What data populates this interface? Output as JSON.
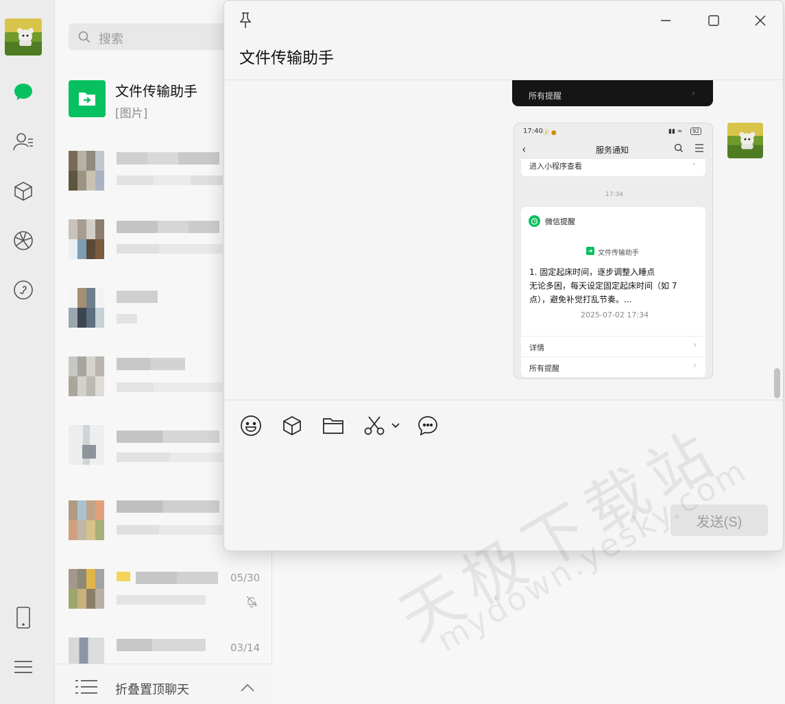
{
  "sidebar": {
    "icons": [
      "chat-icon",
      "contacts-icon",
      "box-icon",
      "aperture-icon",
      "miniapp-icon",
      "phone-icon",
      "menu-icon"
    ],
    "accent": "#07c160"
  },
  "chatlist": {
    "search_placeholder": "搜索",
    "first_chat": {
      "name": "文件传输助手",
      "preview": "[图片]"
    },
    "dates": [
      "05/30",
      "03/14"
    ],
    "fold_label": "折叠置顶聊天"
  },
  "window": {
    "title": "文件传输助手",
    "send_label": "发送(S)"
  },
  "phone_shot": {
    "old_card_label": "所有提醒",
    "status_time": "17:40",
    "status_icons": "ⓐ ●",
    "battery": "92",
    "header_title": "服务通知",
    "miniapp_link": "进入小程序查看",
    "time_sep": "17:34",
    "reminder_label": "微信提醒",
    "from_label": "文件传输助手",
    "content_line1": "1. 固定起床时间，逐步调整入睡点",
    "content_line2": "无论多困，每天设定固定起床时间（如 7",
    "content_line3": "点），避免补觉打乱节奏。...",
    "content_time": "2025-07-02 17:34",
    "details": "详情",
    "all_reminders": "所有提醒"
  },
  "watermark": {
    "cn": "天极下载站",
    "en": "mydown.yesky.com"
  }
}
